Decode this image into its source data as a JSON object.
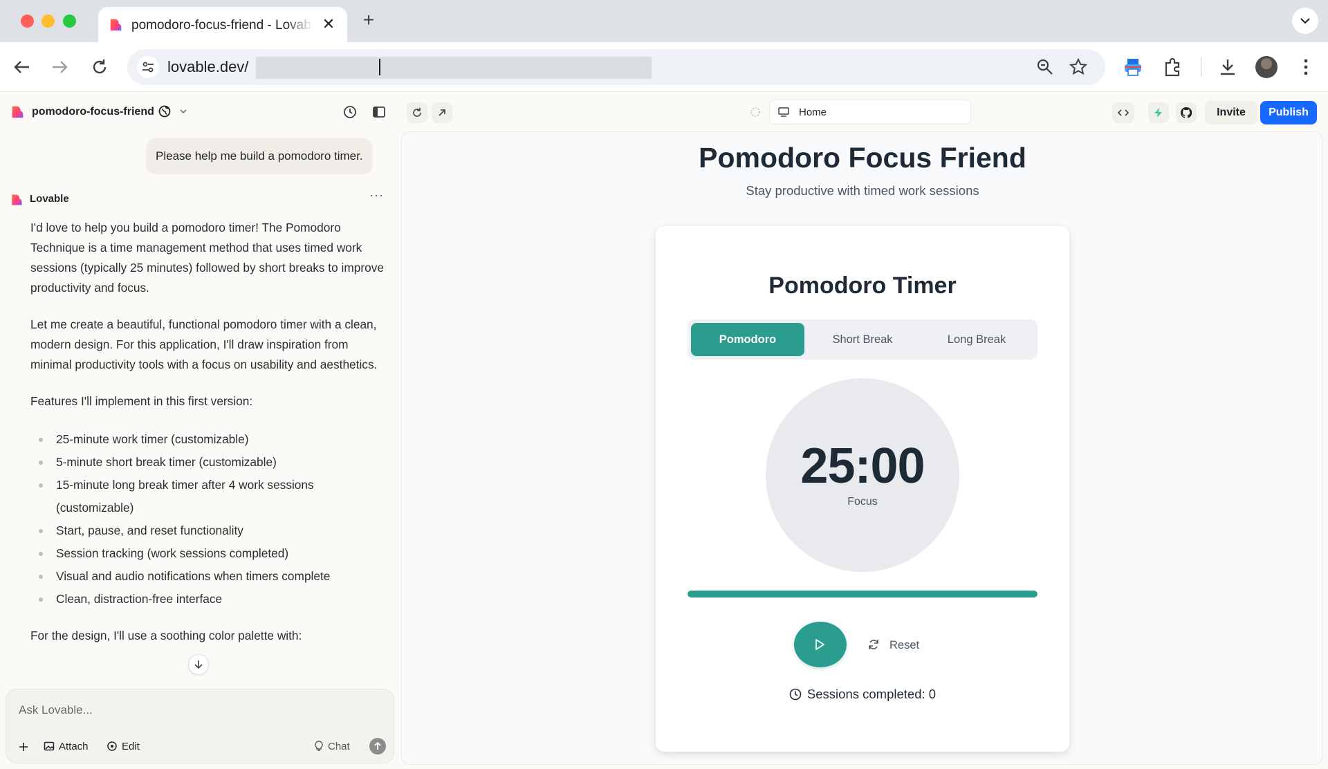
{
  "browser": {
    "tab_title": "pomodoro-focus-friend - Lovable",
    "url": "lovable.dev/"
  },
  "colors": {
    "accent": "#2a9d8f",
    "publish": "#1769ff"
  },
  "chat": {
    "project_name": "pomodoro-focus-friend",
    "user_message": "Please help me build a pomodoro timer.",
    "assistant_name": "Lovable",
    "paragraphs": [
      "I'd love to help you build a pomodoro timer! The Pomodoro Technique is a time management method that uses timed work sessions (typically 25 minutes) followed by short breaks to improve productivity and focus.",
      "Let me create a beautiful, functional pomodoro timer with a clean, modern design. For this application, I'll draw inspiration from minimal productivity tools with a focus on usability and aesthetics.",
      "Features I'll implement in this first version:"
    ],
    "features": [
      "25-minute work timer (customizable)",
      "5-minute short break timer (customizable)",
      "15-minute long break timer after 4 work sessions (customizable)",
      "Start, pause, and reset functionality",
      "Session tracking (work sessions completed)",
      "Visual and audio notifications when timers complete",
      "Clean, distraction-free interface"
    ],
    "design_intro": "For the design, I'll use a soothing color palette with:",
    "composer_placeholder": "Ask Lovable...",
    "attach_label": "Attach",
    "edit_label": "Edit",
    "chat_label": "Chat"
  },
  "preview_header": {
    "route": "Home",
    "invite_label": "Invite",
    "publish_label": "Publish"
  },
  "app": {
    "title": "Pomodoro Focus Friend",
    "subtitle": "Stay productive with timed work sessions",
    "card_title": "Pomodoro Timer",
    "modes": [
      "Pomodoro",
      "Short Break",
      "Long Break"
    ],
    "active_mode": 0,
    "time": "25:00",
    "time_label": "Focus",
    "progress_percent": 100,
    "reset_label": "Reset",
    "sessions_text": "Sessions completed: 0"
  }
}
